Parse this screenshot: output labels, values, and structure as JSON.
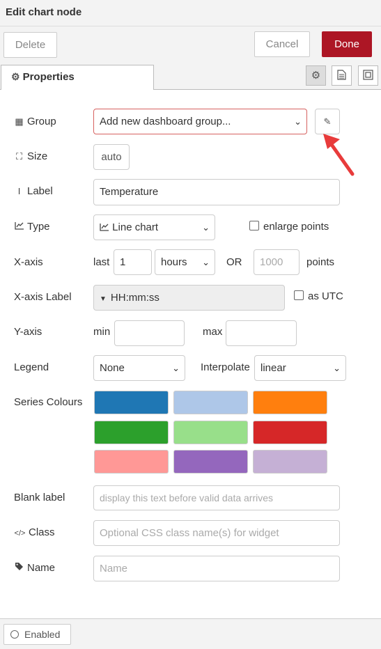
{
  "window": {
    "title": "Edit chart node"
  },
  "toolbar": {
    "delete_label": "Delete",
    "cancel_label": "Cancel",
    "done_label": "Done",
    "done_color": "#ad1625"
  },
  "tabs": {
    "properties_label": "Properties",
    "icons": [
      "gear-icon",
      "description-icon",
      "appearance-icon"
    ]
  },
  "form": {
    "group": {
      "label": "Group",
      "value": "Add new dashboard group...",
      "edit_icon": "pencil-icon"
    },
    "size": {
      "label": "Size",
      "value": "auto"
    },
    "label": {
      "label": "Label",
      "value": "Temperature"
    },
    "type": {
      "label": "Type",
      "value": "Line chart",
      "enlarge_label": "enlarge points"
    },
    "xaxis": {
      "label": "X-axis",
      "last_label": "last",
      "last_value": "1",
      "unit_value": "hours",
      "or_label": "OR",
      "points_placeholder": "1000",
      "points_label": "points"
    },
    "xaxis_label": {
      "label": "X-axis Label",
      "value": "HH:mm:ss",
      "utc_label": "as UTC"
    },
    "yaxis": {
      "label": "Y-axis",
      "min_label": "min",
      "max_label": "max",
      "min_value": "",
      "max_value": ""
    },
    "legend": {
      "label": "Legend",
      "value": "None",
      "interpolate_label": "Interpolate",
      "interpolate_value": "linear"
    },
    "series": {
      "label": "Series Colours",
      "colors": [
        "#1f77b4",
        "#aec7e8",
        "#ff7f0e",
        "#2ca02c",
        "#98df8a",
        "#d62728",
        "#ff9896",
        "#9467bd",
        "#c5b0d5"
      ]
    },
    "blank": {
      "label": "Blank label",
      "placeholder": "display this text before valid data arrives"
    },
    "class": {
      "label": "Class",
      "placeholder": "Optional CSS class name(s) for widget"
    },
    "name": {
      "label": "Name",
      "placeholder": "Name"
    }
  },
  "footer": {
    "enabled_label": "Enabled"
  },
  "annotation": {
    "arrow_color": "#e83b3b"
  }
}
